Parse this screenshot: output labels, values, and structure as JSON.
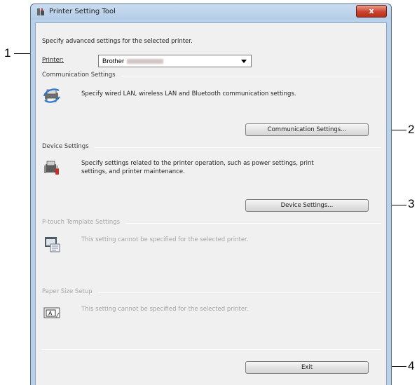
{
  "window": {
    "title": "Printer Setting Tool",
    "close_label": "x"
  },
  "intro": "Specify advanced settings for the selected printer.",
  "printer": {
    "label": "Printer:",
    "value": "Brother"
  },
  "sections": {
    "communication": {
      "header": "Communication Settings",
      "description": "Specify wired LAN, wireless LAN and Bluetooth communication settings.",
      "button": "Communication Settings..."
    },
    "device": {
      "header": "Device Settings",
      "description_line1": "Specify settings related to the printer operation, such as power settings, print",
      "description_line2": "settings, and printer maintenance.",
      "button": "Device Settings..."
    },
    "ptouch": {
      "header": "P-touch Template Settings",
      "description": "This setting cannot be specified for the selected printer."
    },
    "paper": {
      "header": "Paper Size Setup",
      "description": "This setting cannot be specified for the selected printer."
    }
  },
  "exit_button": "Exit",
  "callouts": [
    "1",
    "2",
    "3",
    "4"
  ]
}
